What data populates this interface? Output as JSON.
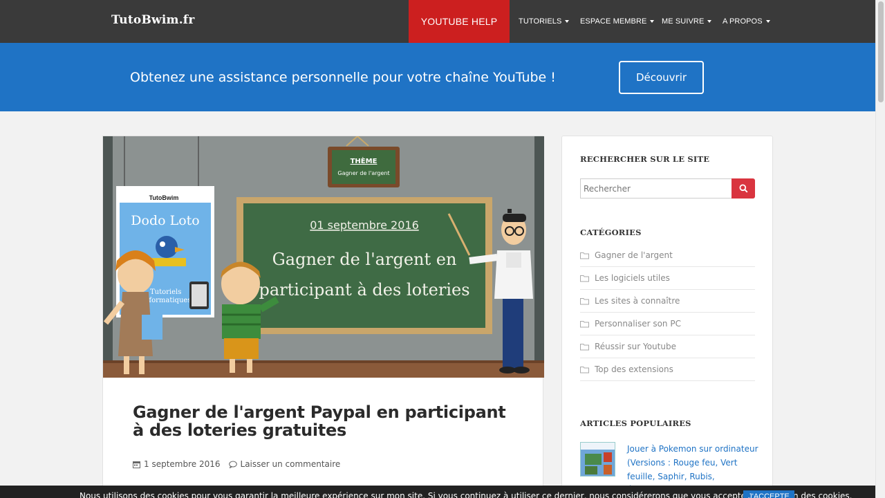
{
  "nav": {
    "brand": "TutoBwim.fr",
    "youtube_help": "YOUTUBE HELP",
    "items": [
      {
        "label": "TUTORIELS"
      },
      {
        "label": "ESPACE MEMBRE"
      },
      {
        "label": "ME SUIVRE"
      },
      {
        "label": "A PROPOS"
      }
    ]
  },
  "banner": {
    "text": "Obtenez une assistance personnelle pour votre chaîne YouTube !",
    "button": "Découvrir"
  },
  "hero": {
    "theme_label": "THÈME",
    "theme_value": "Gagner de l'argent",
    "date": "01 septembre 2016",
    "board_line1": "Gagner de l'argent en",
    "board_line2": "participant à des loteries",
    "poster_brand": "TutoBwim",
    "poster_title": "Dodo Loto",
    "poster_sub1": "Tutoriels",
    "poster_sub2": "Informatiques"
  },
  "article": {
    "title": "Gagner de l'argent Paypal en participant à des loteries gratuites",
    "date": "1 septembre 2016",
    "comment": "Laisser un commentaire"
  },
  "sidebar": {
    "search_heading": "RECHERCHER SUR LE SITE",
    "search_placeholder": "Rechercher",
    "categories_heading": "CATÉGORIES",
    "categories": [
      {
        "label": "Gagner de l'argent"
      },
      {
        "label": "Les logiciels utiles"
      },
      {
        "label": "Les sites à connaître"
      },
      {
        "label": "Personnaliser son PC"
      },
      {
        "label": "Réussir sur Youtube"
      },
      {
        "label": "Top des extensions"
      }
    ],
    "popular_heading": "ARTICLES POPULAIRES",
    "popular": [
      {
        "title": "Jouer à Pokemon sur ordinateur (Versions : Rouge feu, Vert feuille, Saphir, Rubis, Émeraude)"
      }
    ]
  },
  "cookie": {
    "text": "Nous utilisons des cookies pour vous garantir la meilleure expérience sur mon site. Si vous continuez à utiliser ce dernier, nous considérerons que vous acceptez l'utilisation des cookies.",
    "button": "J'ACCEPTE"
  },
  "colors": {
    "navbar": "#3a3a3a",
    "youtube_red": "#cc1f1f",
    "banner_blue": "#1f73c5",
    "search_red": "#d9343f"
  }
}
